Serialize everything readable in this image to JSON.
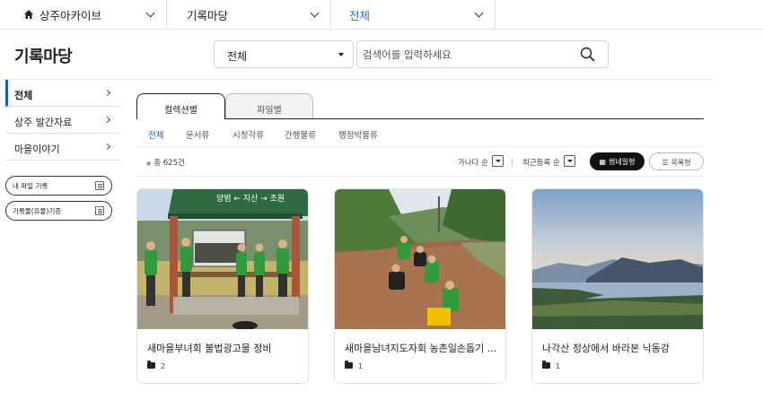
{
  "breadcrumb": {
    "home_label": "상주아카이브",
    "level2": "기록마당",
    "level3": "전체"
  },
  "page_title": "기록마당",
  "search": {
    "scope_value": "전체",
    "placeholder": "검색어를 입력하세요"
  },
  "sidebar": {
    "items": [
      {
        "label": "전체"
      },
      {
        "label": "상주 발간자료"
      },
      {
        "label": "마을이야기"
      }
    ],
    "buttons": [
      {
        "label": "내 파일 기록"
      },
      {
        "label": "기록물(유물)기증"
      }
    ]
  },
  "tabs": [
    {
      "label": "컬렉션별"
    },
    {
      "label": "파일별"
    }
  ],
  "subtabs": [
    {
      "label": "전체"
    },
    {
      "label": "문서류"
    },
    {
      "label": "시청각류"
    },
    {
      "label": "간행물류"
    },
    {
      "label": "행정박물류"
    }
  ],
  "toolbar": {
    "count": "총 625건",
    "sort1": "가나다 순",
    "sort2": "최근등록 순",
    "view_thumb": "썸네일형",
    "view_list": "목록형"
  },
  "cards": [
    {
      "title": "새마을부녀회 불법광고물 정비",
      "count": "2"
    },
    {
      "title": "새마을남녀지도자회 농촌일손돕기 ...",
      "count": "1"
    },
    {
      "title": "나각산 정상에서 바라본 낙동강",
      "count": "1"
    }
  ],
  "photo_text": {
    "bus_stop_sign": "양범 ← 지산 → 조원"
  },
  "colors": {
    "accent": "#1e5bbf",
    "dark_button": "#111111"
  }
}
